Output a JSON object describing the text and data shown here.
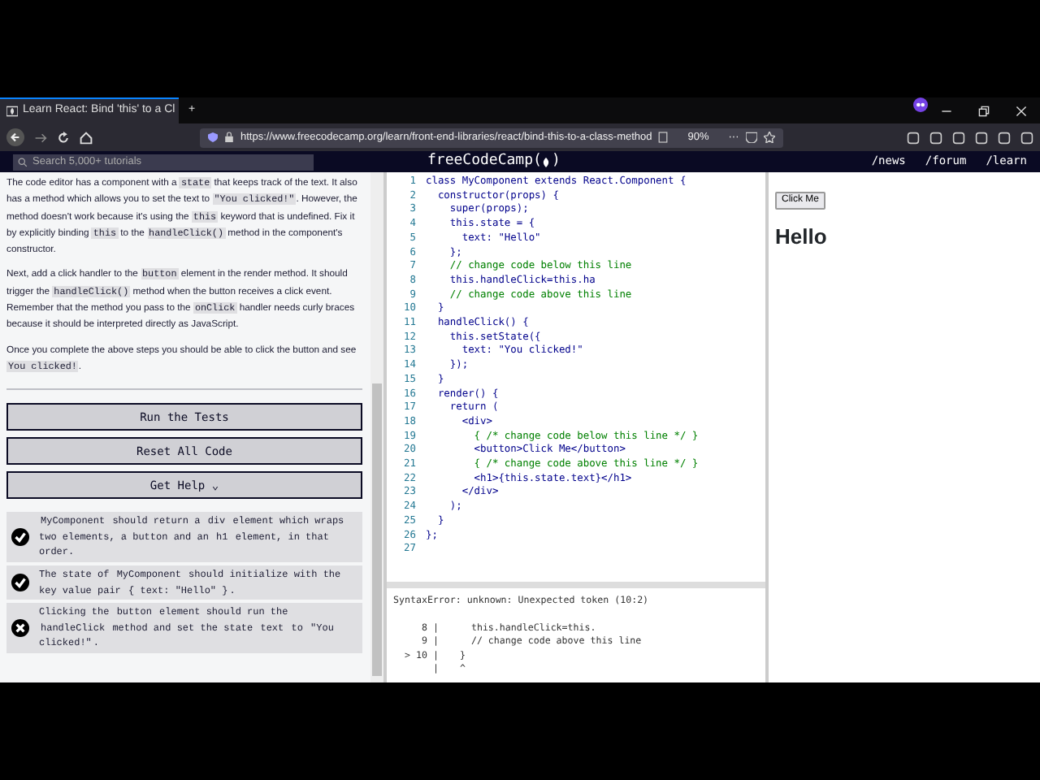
{
  "browser": {
    "tab": {
      "title": "Learn React: Bind 'this' to a Cl",
      "selected": true
    },
    "new_tab": "+",
    "url": "https://www.freecodecamp.org/learn/front-end-libraries/react/bind-this-to-a-class-method",
    "zoom": "90%",
    "more": "···"
  },
  "site_nav": {
    "search": {
      "placeholder": "Search 5,000+ tutorials"
    },
    "logo": {
      "name": "freeCodeCamp",
      "open": "(",
      "close": ")"
    },
    "links": [
      "/news",
      "/forum",
      "/learn"
    ]
  },
  "instructions": [
    [
      {
        "text": "The code editor has a component with a "
      },
      {
        "text": "state",
        "code": true
      },
      {
        "text": " that keeps track of the text. It also has a method which allows you to set the text to "
      },
      {
        "text": "\"You clicked!\"",
        "code": true
      },
      {
        "text": ". However, the method doesn't work because it's using the "
      },
      {
        "text": "this",
        "code": true
      },
      {
        "text": " keyword that is undefined. Fix it by explicitly binding "
      },
      {
        "text": "this",
        "code": true
      },
      {
        "text": " to the "
      },
      {
        "text": "handleClick()",
        "code": true
      },
      {
        "text": " method in the component's constructor."
      }
    ],
    [
      {
        "text": "Next, add a click handler to the "
      },
      {
        "text": "button",
        "code": true
      },
      {
        "text": " element in the render method. It should trigger the "
      },
      {
        "text": "handleClick()",
        "code": true
      },
      {
        "text": " method when the button receives a click event. Remember that the method you pass to the "
      },
      {
        "text": "onClick",
        "code": true
      },
      {
        "text": " handler needs curly braces because it should be interpreted directly as JavaScript."
      }
    ],
    [
      {
        "text": "Once you complete the above steps you should be able to click the button and see "
      },
      {
        "text": "You clicked!",
        "code": true
      },
      {
        "text": "."
      }
    ]
  ],
  "buttons": [
    "Run the Tests",
    "Reset All Code",
    "Get Help ⌄"
  ],
  "tests": [
    {
      "passed": true,
      "parts": [
        {
          "text": "MyComponent",
          "code": true
        },
        {
          "text": " should return a "
        },
        {
          "text": "div",
          "code": true
        },
        {
          "text": " element which wraps two elements, a button and an "
        },
        {
          "text": "h1",
          "code": true
        },
        {
          "text": " element, in that order."
        }
      ]
    },
    {
      "passed": true,
      "parts": [
        {
          "text": "The state of "
        },
        {
          "text": "MyComponent",
          "code": true
        },
        {
          "text": " should initialize with the key value pair "
        },
        {
          "text": "{ text: \"Hello\" }",
          "code": true
        },
        {
          "text": "."
        }
      ]
    },
    {
      "passed": false,
      "parts": [
        {
          "text": "Clicking the "
        },
        {
          "text": "button",
          "code": true
        },
        {
          "text": " element should run the "
        },
        {
          "text": "handleClick",
          "code": true
        },
        {
          "text": " method and set the state "
        },
        {
          "text": "text",
          "code": true
        },
        {
          "text": " to "
        },
        {
          "text": "\"You clicked!\"",
          "code": true
        },
        {
          "text": "."
        }
      ]
    }
  ],
  "editor": {
    "lines": [
      {
        "number": "1",
        "text": "class MyComponent extends React.Component {",
        "kind": "code"
      },
      {
        "number": "2",
        "text": "  constructor(props) {",
        "kind": "code"
      },
      {
        "number": "3",
        "text": "    super(props);",
        "kind": "code"
      },
      {
        "number": "4",
        "text": "    this.state = {",
        "kind": "code"
      },
      {
        "number": "5",
        "text": "      text: \"Hello\"",
        "kind": "code"
      },
      {
        "number": "6",
        "text": "    };",
        "kind": "code"
      },
      {
        "number": "7",
        "text": "    // change code below this line",
        "kind": "comment"
      },
      {
        "number": "8",
        "text": "    this.handleClick=this.ha",
        "kind": "code"
      },
      {
        "number": "9",
        "text": "    // change code above this line",
        "kind": "comment"
      },
      {
        "number": "10",
        "text": "  }",
        "kind": "code"
      },
      {
        "number": "11",
        "text": "  handleClick() {",
        "kind": "code"
      },
      {
        "number": "12",
        "text": "    this.setState({",
        "kind": "code"
      },
      {
        "number": "13",
        "text": "      text: \"You clicked!\"",
        "kind": "code"
      },
      {
        "number": "14",
        "text": "    });",
        "kind": "code"
      },
      {
        "number": "15",
        "text": "  }",
        "kind": "code"
      },
      {
        "number": "16",
        "text": "  render() {",
        "kind": "code"
      },
      {
        "number": "17",
        "text": "    return (",
        "kind": "code"
      },
      {
        "number": "18",
        "text": "      <div>",
        "kind": "code"
      },
      {
        "number": "19",
        "text": "        { /* change code below this line */ }",
        "kind": "comment"
      },
      {
        "number": "20",
        "text": "        <button>Click Me</button>",
        "kind": "code"
      },
      {
        "number": "21",
        "text": "        { /* change code above this line */ }",
        "kind": "comment"
      },
      {
        "number": "22",
        "text": "        <h1>{this.state.text}</h1>",
        "kind": "code"
      },
      {
        "number": "23",
        "text": "      </div>",
        "kind": "code"
      },
      {
        "number": "24",
        "text": "    );",
        "kind": "code"
      },
      {
        "number": "25",
        "text": "  }",
        "kind": "code"
      },
      {
        "number": "26",
        "text": "};",
        "kind": "code"
      },
      {
        "number": "27",
        "kind": "code"
      }
    ]
  },
  "console": {
    "error": "SyntaxError: unknown: Unexpected token (10:2)",
    "frame": [
      {
        "gutter": "8 |",
        "text": "    this.handleClick=this."
      },
      {
        "gutter": "9 |",
        "text": "    // change code above this line"
      },
      {
        "gutter": "> 10 |",
        "text": "  }"
      },
      {
        "gutter": "|",
        "text": "  ^"
      }
    ]
  },
  "preview": {
    "button": "Click Me",
    "heading": "Hello"
  }
}
